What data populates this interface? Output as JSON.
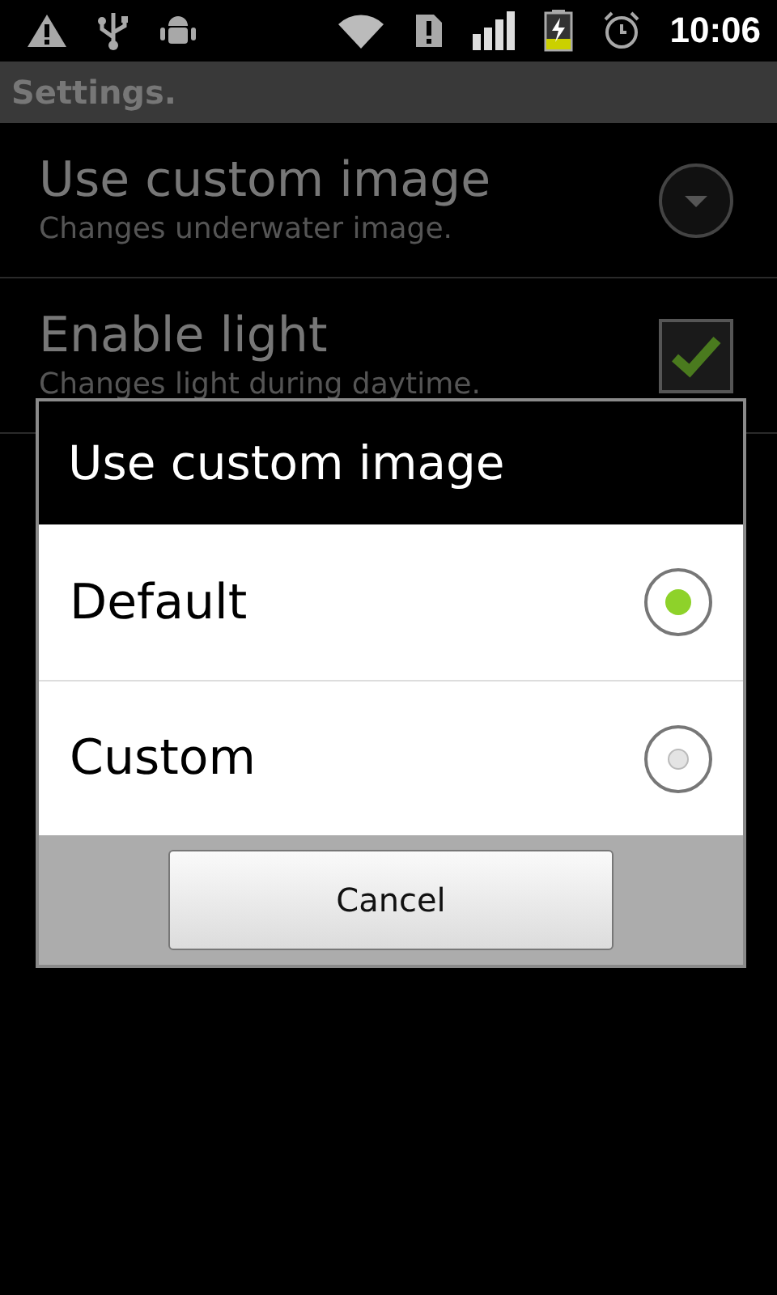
{
  "status_bar": {
    "time": "10:06"
  },
  "title_bar": {
    "title": "Settings."
  },
  "preferences": [
    {
      "kind": "list",
      "title": "Use custom image",
      "summary": "Changes underwater image."
    },
    {
      "kind": "checkbox",
      "title": "Enable light",
      "summary": "Changes light during daytime.",
      "checked": true
    }
  ],
  "dialog": {
    "title": "Use custom image",
    "options": [
      {
        "label": "Default",
        "selected": true
      },
      {
        "label": "Custom",
        "selected": false
      }
    ],
    "buttons": [
      "Cancel"
    ]
  }
}
